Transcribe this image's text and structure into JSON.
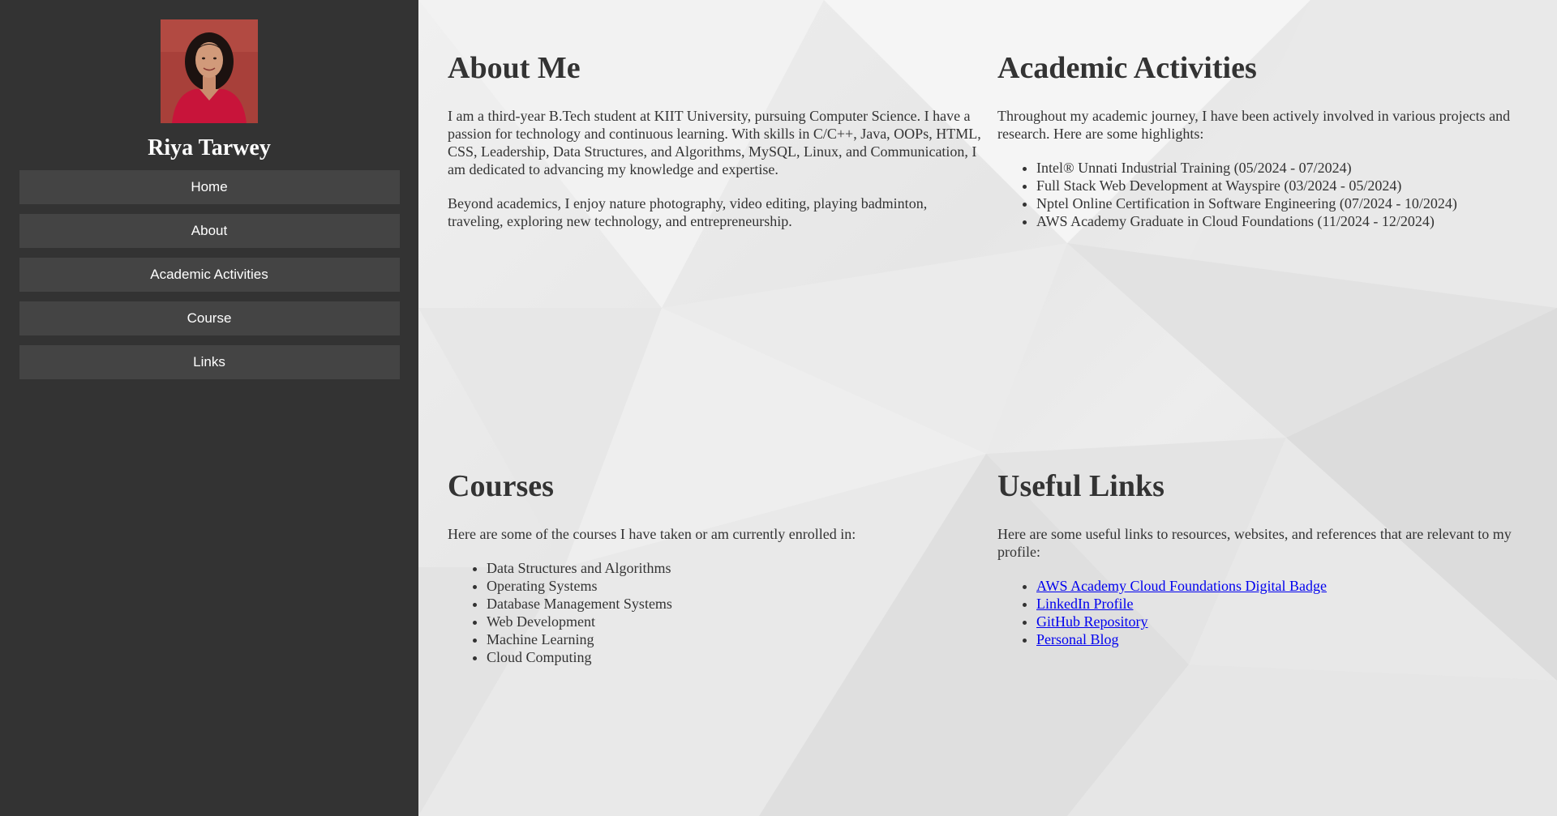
{
  "profile": {
    "name": "Riya Tarwey",
    "avatar_alt": "profile-photo"
  },
  "nav": {
    "items": [
      {
        "label": "Home"
      },
      {
        "label": "About"
      },
      {
        "label": "Academic Activities"
      },
      {
        "label": "Course"
      },
      {
        "label": "Links"
      }
    ]
  },
  "about": {
    "title": "About Me",
    "paragraphs": [
      "I am a third-year B.Tech student at KIIT University, pursuing Computer Science. I have a passion for technology and continuous learning. With skills in C/C++, Java, OOPs, HTML, CSS, Leadership, Data Structures, and Algorithms, MySQL, Linux, and Communication, I am dedicated to advancing my knowledge and expertise.",
      "Beyond academics, I enjoy nature photography, video editing, playing badminton, traveling, exploring new technology, and entrepreneurship."
    ]
  },
  "academic": {
    "title": "Academic Activities",
    "intro": "Throughout my academic journey, I have been actively involved in various projects and research. Here are some highlights:",
    "items": [
      "Intel® Unnati Industrial Training (05/2024 - 07/2024)",
      "Full Stack Web Development at Wayspire (03/2024 - 05/2024)",
      "Nptel Online Certification in Software Engineering (07/2024 - 10/2024)",
      "AWS Academy Graduate in Cloud Foundations (11/2024 - 12/2024)"
    ]
  },
  "courses": {
    "title": "Courses",
    "intro": "Here are some of the courses I have taken or am currently enrolled in:",
    "items": [
      "Data Structures and Algorithms",
      "Operating Systems",
      "Database Management Systems",
      "Web Development",
      "Machine Learning",
      "Cloud Computing"
    ]
  },
  "links": {
    "title": "Useful Links",
    "intro": "Here are some useful links to resources, websites, and references that are relevant to my profile:",
    "items": [
      "AWS Academy Cloud Foundations Digital Badge",
      "LinkedIn Profile",
      "GitHub Repository",
      "Personal Blog"
    ]
  },
  "colors": {
    "sidebar_bg": "#333333",
    "nav_item_bg": "#444444",
    "link": "#0000ee",
    "text": "#333333"
  }
}
